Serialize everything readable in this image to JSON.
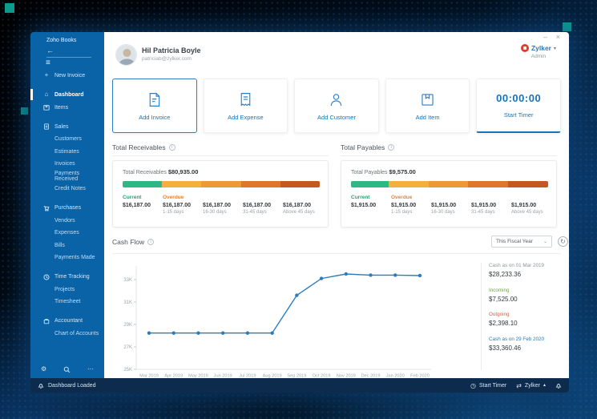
{
  "window": {
    "minimize_icon": "–",
    "close_icon": "×"
  },
  "sidebar": {
    "brand": "Zoho Books",
    "new_invoice": "New Invoice",
    "dashboard": "Dashboard",
    "items_label": "Items",
    "sections": [
      {
        "label": "Sales",
        "children": [
          "Customers",
          "Estimates",
          "Invoices",
          "Payments Received",
          "Credit Notes"
        ]
      },
      {
        "label": "Purchases",
        "children": [
          "Vendors",
          "Expenses",
          "Bills",
          "Payments Made"
        ]
      },
      {
        "label": "Time Tracking",
        "children": [
          "Projects",
          "Timesheet"
        ]
      },
      {
        "label": "Accountant",
        "children": [
          "Chart of Accounts"
        ]
      }
    ]
  },
  "header": {
    "name": "Hil Patricia Boyle",
    "email": "patriciab@zylker.com",
    "org": "Zylker",
    "role": "Admin"
  },
  "quick_actions": {
    "cards": [
      {
        "label": "Add Invoice"
      },
      {
        "label": "Add Expense"
      },
      {
        "label": "Add Customer"
      },
      {
        "label": "Add Item"
      }
    ],
    "timer_time": "00:00:00",
    "timer_label": "Start Timer"
  },
  "receivables": {
    "title": "Total Receivables",
    "total_label": "Total Receivables",
    "total_amount": "$80,935.00",
    "bar": [
      {
        "color": "#2eb886",
        "pct": 20
      },
      {
        "color": "#f2b13e",
        "pct": 20
      },
      {
        "color": "#eb9a38",
        "pct": 20
      },
      {
        "color": "#dc782e",
        "pct": 20
      },
      {
        "color": "#c05a20",
        "pct": 20
      }
    ],
    "columns": [
      {
        "label": "Current",
        "amount": "$16,187.00",
        "sub": ""
      },
      {
        "label": "Overdue",
        "amount": "$16,187.00",
        "sub": "1-15 days"
      },
      {
        "label": "",
        "amount": "$16,187.00",
        "sub": "16-30 days"
      },
      {
        "label": "",
        "amount": "$16,187.00",
        "sub": "31-45 days"
      },
      {
        "label": "",
        "amount": "$16,187.00",
        "sub": "Above 45 days"
      }
    ]
  },
  "payables": {
    "title": "Total Payables",
    "total_label": "Total Payables",
    "total_amount": "$9,575.00",
    "bar": [
      {
        "color": "#2eb886",
        "pct": 19
      },
      {
        "color": "#f2b13e",
        "pct": 20.25
      },
      {
        "color": "#eb9a38",
        "pct": 20.25
      },
      {
        "color": "#dc782e",
        "pct": 20.25
      },
      {
        "color": "#c05a20",
        "pct": 20.25
      }
    ],
    "columns": [
      {
        "label": "Current",
        "amount": "$1,915.00",
        "sub": ""
      },
      {
        "label": "Overdue",
        "amount": "$1,915.00",
        "sub": "1-15 days"
      },
      {
        "label": "",
        "amount": "$1,915.00",
        "sub": "16-30 days"
      },
      {
        "label": "",
        "amount": "$1,915.00",
        "sub": "31-45 days"
      },
      {
        "label": "",
        "amount": "$1,915.00",
        "sub": "Above 45 days"
      }
    ]
  },
  "cashflow": {
    "title": "Cash Flow",
    "filter_label": "This Fiscal Year",
    "panel": [
      {
        "label": "Cash as on 01 Mar 2019",
        "value": "$28,233.36"
      },
      {
        "label": "Incoming",
        "value": "$7,525.00"
      },
      {
        "label": "Outgoing",
        "value": "$2,398.10"
      },
      {
        "label": "Cash as on 29 Feb 2020",
        "value": "$33,360.46"
      }
    ]
  },
  "chart_data": {
    "type": "line",
    "title": "Cash Flow",
    "x": [
      "Mar 2019",
      "Apr 2019",
      "May 2019",
      "Jun 2019",
      "Jul 2019",
      "Aug 2019",
      "Sep 2019",
      "Oct 2019",
      "Nov 2019",
      "Dec 2019",
      "Jan 2020",
      "Feb 2020"
    ],
    "values": [
      28233,
      28233,
      28233,
      28233,
      28233,
      28233,
      31600,
      33100,
      33500,
      33400,
      33400,
      33360
    ],
    "yticks": [
      {
        "label": "25K",
        "value": 25000
      },
      {
        "label": "27K",
        "value": 27000
      },
      {
        "label": "29K",
        "value": 29000
      },
      {
        "label": "31K",
        "value": 31000
      },
      {
        "label": "33K",
        "value": 33000
      }
    ],
    "ylim": [
      25000,
      34600
    ],
    "xlabel": "",
    "ylabel": "",
    "grid": false,
    "legend": false,
    "line_color": "#2c7cbe"
  },
  "statusbar": {
    "message": "Dashboard Loaded",
    "start_timer": "Start Timer",
    "org": "Zylker"
  },
  "colors": {
    "accent": "#1374bb",
    "sidebar_blue": "#0a62a7",
    "statusbar_navy": "#0d2c4d",
    "current_green": "#27a376",
    "overdue_orange": "#e8862f",
    "incoming_green": "#7aa33c",
    "outgoing_red": "#d0634c",
    "link_blue": "#2e79b5",
    "chart_line": "#2c7cbe",
    "org_logo_red": "#e23b2e",
    "deco_teal": "#0e9a8d"
  }
}
